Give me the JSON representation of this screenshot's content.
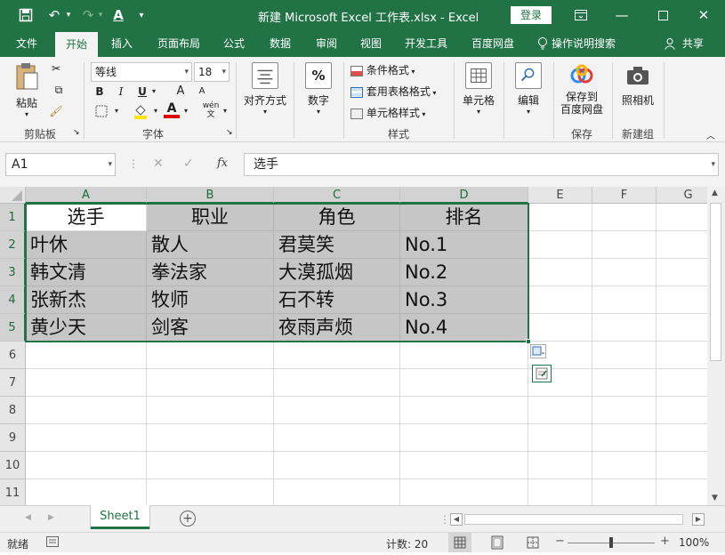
{
  "title_bar": {
    "save_icon": "save-icon",
    "undo_icon": "undo-icon",
    "redo_icon": "redo-icon",
    "font_color_icon": "font-color-icon",
    "customize_icon": "customize-quick-access-icon",
    "title": "新建 Microsoft Excel 工作表.xlsx  -  Excel",
    "login_label": "登录",
    "ribbon_display_icon": "ribbon-display-options-icon",
    "minimize_icon": "minimize-icon",
    "maximize_icon": "maximize-icon",
    "close_icon": "close-icon",
    "accent": "#217346"
  },
  "tabs": [
    {
      "label": "文件"
    },
    {
      "label": "开始"
    },
    {
      "label": "插入"
    },
    {
      "label": "页面布局"
    },
    {
      "label": "公式"
    },
    {
      "label": "数据"
    },
    {
      "label": "审阅"
    },
    {
      "label": "视图"
    },
    {
      "label": "开发工具"
    },
    {
      "label": "百度网盘"
    },
    {
      "label": "操作说明搜索"
    }
  ],
  "share_label": "共享",
  "ribbon": {
    "clipboard": {
      "paste_label": "粘贴",
      "group_label": "剪贴板"
    },
    "font": {
      "name": "等线",
      "size": "18",
      "bold": "B",
      "italic": "I",
      "underline": "U",
      "grow": "A",
      "shrink": "A",
      "group_label": "字体",
      "phonetic": "wén"
    },
    "alignment": {
      "label": "对齐方式"
    },
    "number": {
      "label": "数字",
      "symbol": "%"
    },
    "styles": {
      "conditional": "条件格式",
      "table": "套用表格格式",
      "cell_styles": "单元格样式",
      "group_label": "样式"
    },
    "cells": {
      "label": "单元格"
    },
    "editing": {
      "label": "编辑"
    },
    "save": {
      "label_line1": "保存到",
      "label_line2": "百度网盘",
      "group_label": "保存"
    },
    "camera": {
      "label": "照相机",
      "group_label": "新建组"
    }
  },
  "formula_bar": {
    "name_box": "A1",
    "cancel_icon": "cancel-icon",
    "enter_icon": "enter-icon",
    "fx": "fx",
    "content": "选手"
  },
  "columns": [
    "A",
    "B",
    "C",
    "D",
    "E",
    "F",
    "G"
  ],
  "rows": [
    "1",
    "2",
    "3",
    "4",
    "5",
    "6",
    "7",
    "8",
    "9",
    "10",
    "11"
  ],
  "table": [
    [
      "选手",
      "职业",
      "角色",
      "排名"
    ],
    [
      "叶休",
      "散人",
      "君莫笑",
      "No.1"
    ],
    [
      "韩文清",
      "拳法家",
      "大漠孤烟",
      "No.2"
    ],
    [
      "张新杰",
      "牧师",
      "石不转",
      "No.3"
    ],
    [
      "黄少天",
      "剑客",
      "夜雨声烦",
      "No.4"
    ]
  ],
  "sheet_tabs": [
    {
      "label": "Sheet1"
    }
  ],
  "status": {
    "ready": "就绪",
    "count": "计数: 20",
    "zoom": "100%",
    "minus": "−",
    "plus": "+"
  }
}
